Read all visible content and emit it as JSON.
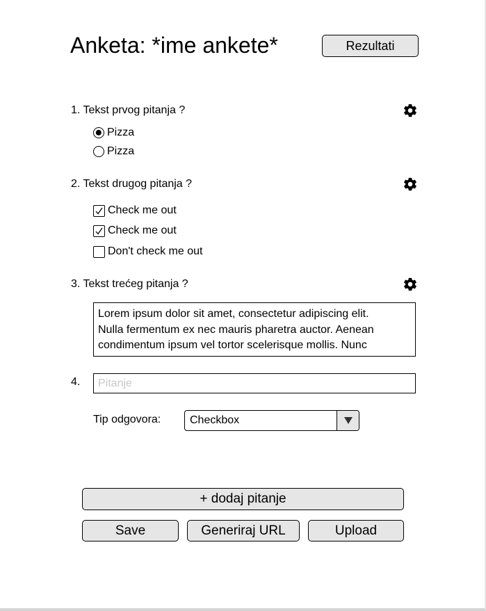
{
  "header": {
    "title": "Anketa: *ime ankete*",
    "results_button": "Rezultati"
  },
  "questions": [
    {
      "text": "1. Tekst prvog pitanja ?",
      "settings_icon": "gear-icon",
      "type": "radio",
      "options": [
        {
          "label": "Pizza",
          "selected": true
        },
        {
          "label": "Pizza",
          "selected": false
        }
      ]
    },
    {
      "text": "2. Tekst drugog pitanja ?",
      "settings_icon": "gear-icon",
      "type": "checkbox",
      "options": [
        {
          "label": "Check me out",
          "checked": true
        },
        {
          "label": "Check me out",
          "checked": true
        },
        {
          "label": "Don't check me out",
          "checked": false
        }
      ]
    },
    {
      "text": "3. Tekst trećeg pitanja ?",
      "settings_icon": "gear-icon",
      "type": "text",
      "answer_lines": [
        "Lorem ipsum dolor sit amet, consectetur adipiscing elit.",
        "Nulla fermentum ex nec mauris pharetra auctor. Aenean",
        "condimentum ipsum vel tortor scelerisque mollis. Nunc"
      ]
    }
  ],
  "new_question": {
    "number": "4.",
    "placeholder": "Pitanje",
    "value": "",
    "answer_type_label": "Tip odgovora:",
    "answer_type_value": "Checkbox"
  },
  "actions": {
    "add_question": "+ dodaj pitanje",
    "save": "Save",
    "generate_url": "Generiraj URL",
    "upload": "Upload"
  }
}
